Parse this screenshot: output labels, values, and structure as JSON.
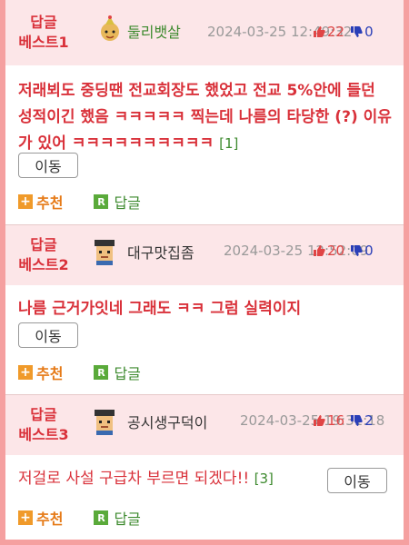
{
  "comments": [
    {
      "badge_line1": "답글",
      "badge_line2": "베스트1",
      "avatar_icon": "birthday-hat-character-icon",
      "author": "둘리뱃살",
      "date": "2024-03-25 12:49:32",
      "up_votes": "22",
      "down_votes": "0",
      "text": "저래뵈도 중딩땐 전교회장도 했었고 전교 5%안에 들던 성적이긴 했음 ㅋㅋㅋㅋㅋ 찍는데 나름의 타당한 (?) 이유가 있어 ㅋㅋㅋㅋㅋㅋㅋㅋㅋㅋ",
      "reply_count": "[1]",
      "move_label": "이동",
      "recommend_label": "추천",
      "reply_label": "답글"
    },
    {
      "badge_line1": "답글",
      "badge_line2": "베스트2",
      "avatar_icon": "graduate-character-icon",
      "author": "대구맛집좀",
      "date": "2024-03-25 12:52:09",
      "up_votes": "20",
      "down_votes": "0",
      "text": "나름 근거가잇네 그래도 ㅋㅋ 그럼 실력이지",
      "reply_count": "",
      "move_label": "이동",
      "recommend_label": "추천",
      "reply_label": "답글"
    },
    {
      "badge_line1": "답글",
      "badge_line2": "베스트3",
      "avatar_icon": "graduate-character-icon",
      "author": "공시생구덕이",
      "date": "2024-03-25 19:31:18",
      "up_votes": "16",
      "down_votes": "2",
      "text": "저걸로 사설 구급차 부르면 되겠다!!",
      "reply_count": "[3]",
      "move_label": "이동",
      "recommend_label": "추천",
      "reply_label": "답글"
    }
  ],
  "colors": {
    "badge_red": "#d9313a",
    "header_bg": "#fce6e8",
    "border_pink": "#f5a0a0",
    "green": "#3d8a2e",
    "orange": "#e67a17"
  }
}
